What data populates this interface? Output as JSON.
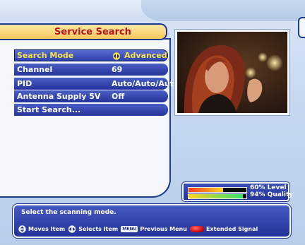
{
  "screen": {
    "title": "Service Search",
    "menu": [
      {
        "label": "Search Mode",
        "value": "Advanced",
        "selected": true,
        "has_arrows": true
      },
      {
        "label": "Channel",
        "value": "69",
        "selected": false,
        "has_arrows": false
      },
      {
        "label": "PID",
        "value": "Auto/Auto/Auto",
        "selected": false,
        "has_arrows": false
      },
      {
        "label": "Antenna Supply 5V",
        "value": "Off",
        "selected": false,
        "has_arrows": false
      },
      {
        "label": "Start Search...",
        "value": "",
        "selected": false,
        "has_arrows": false
      }
    ]
  },
  "signal": {
    "level_percent": 60,
    "quality_percent": 94,
    "level_text": "60% Level",
    "quality_text": "94% Quality"
  },
  "help": {
    "text": "Select the scanning mode.",
    "legend": {
      "moves": "Moves Item",
      "selects": "Selects Item",
      "menu_key": "MENU",
      "previous": "Previous Menu",
      "extended": "Extended Signal"
    }
  },
  "icons": {
    "updown": "up-down-arrows-icon",
    "leftright": "left-right-arrows-icon",
    "red": "red-button-icon"
  },
  "colors": {
    "selected_text": "#f7e24a",
    "title_text": "#b8141e",
    "row_bg": "#24339a"
  }
}
